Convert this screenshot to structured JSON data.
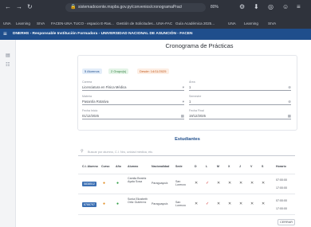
{
  "browser": {
    "url": "sistemadocente.mspbs.gov.py/convenios/cronogramaPracticas/ver/",
    "zoom": "80%"
  },
  "bookmarks": [
    "UNA",
    "Learning",
    "SIVA",
    "FACEN-UNA",
    "TUCO - espacio E-Ras...",
    "Gestión de Solicitudes...",
    "UNA-FAC",
    "Guía Académica 2025...",
    "UNA",
    "Learning",
    "SIVA"
  ],
  "app": {
    "title": "DNERHS - Responsable Institución Formadora - UNIVERSIDAD NACIONAL DE ASUNCIÓN - FACEN"
  },
  "page": {
    "title": "Cronograma de Prácticas",
    "pills": [
      "5 Alumnos",
      "2 Grupo(s)",
      "Desde: 14/11/2025"
    ],
    "fields": [
      {
        "label": "Carrera",
        "value": "Licenciatura en Física Médica"
      },
      {
        "label": "Área",
        "value": "1"
      },
      {
        "label": "Materia",
        "value": "Pasantía Rotativa"
      },
      {
        "label": "Semestre",
        "value": "1"
      },
      {
        "label": "Fecha Inicio",
        "value": "01/12/2025"
      },
      {
        "label": "Fecha Final",
        "value": "19/12/2025"
      }
    ],
    "students_title": "Estudiantes",
    "search_placeholder": "Buscar por alumno, C.I. Nro, unidad médica, etc.",
    "columns": [
      "C.I. Alumno",
      "Curso",
      "Año",
      "Alumno",
      "Nacionalidad",
      "Sede",
      "D",
      "L",
      "M",
      "X",
      "J",
      "V",
      "S",
      "Horario"
    ],
    "rows": [
      {
        "ci": "5838512",
        "alumno": "Camila Beatriz Ayala Sosa",
        "nac": "Paraguayo/a",
        "sede": "San Lorenzo",
        "h1": "07:00:00",
        "h2": "17:00:00"
      },
      {
        "ci": "6766797",
        "alumno": "Sonia Elizabeth Ortiz Gutiérrez",
        "nac": "Paraguayo/a",
        "sede": "San Lorenzo",
        "h1": "07:00:00",
        "h2": "17:00:00"
      }
    ],
    "close_label": "CERRAR"
  }
}
